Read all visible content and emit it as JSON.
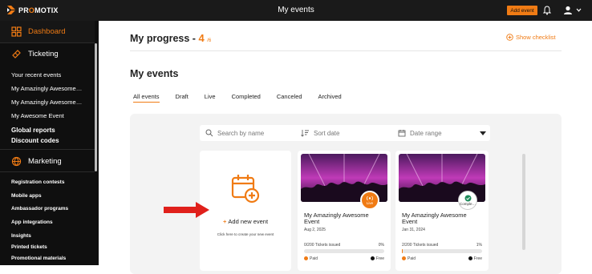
{
  "topbar": {
    "logo_text_1": "PR",
    "logo_text_o": "O",
    "logo_text_2": "MOTIX",
    "title": "My events",
    "add_event_label": "Add event",
    "colors": {
      "bg": "#1a1a1a",
      "accent": "#f07b14"
    }
  },
  "sidebar": {
    "dashboard": "Dashboard",
    "ticketing": "Ticketing",
    "recent_heading": "Your recent events",
    "recent_events": [
      "My Amazingly Awesome…",
      "My Amazingly Awesome…",
      "My Awesome Event"
    ],
    "global_reports": "Global reports",
    "discount_codes": "Discount codes",
    "marketing": "Marketing",
    "marketing_items": [
      "Registration contests",
      "Mobile apps",
      "Ambassador programs",
      "App integrations",
      "Insights",
      "Printed tickets",
      "Promotional materials"
    ]
  },
  "progress": {
    "title": "My progress -",
    "value": "4",
    "unit": "/6",
    "show_checklist": "Show checklist"
  },
  "events": {
    "title": "My events",
    "tabs": [
      "All events",
      "Draft",
      "Live",
      "Completed",
      "Canceled",
      "Archived"
    ],
    "active_tab": "All events",
    "search_placeholder": "Search by name",
    "sort_placeholder": "Sort date",
    "date_range_placeholder": "Date range",
    "add_new_label": "Add new event",
    "add_new_hint": "Click here to create your new event",
    "cards": [
      {
        "title": "My Amazingly Awesome Event",
        "date": "Aug 2, 2025",
        "tickets_issued": "0/200 Tickets issued",
        "percent": "0%",
        "paid_label": "Paid",
        "free_label": "Free",
        "status": "Live",
        "progress": 0
      },
      {
        "title": "My Amazingly Awesome Event",
        "date": "Jan 31, 2024",
        "tickets_issued": "2/200 Tickets issued",
        "percent": "1%",
        "paid_label": "Paid",
        "free_label": "Free",
        "status": "Comple…",
        "progress": 0.01
      }
    ]
  }
}
